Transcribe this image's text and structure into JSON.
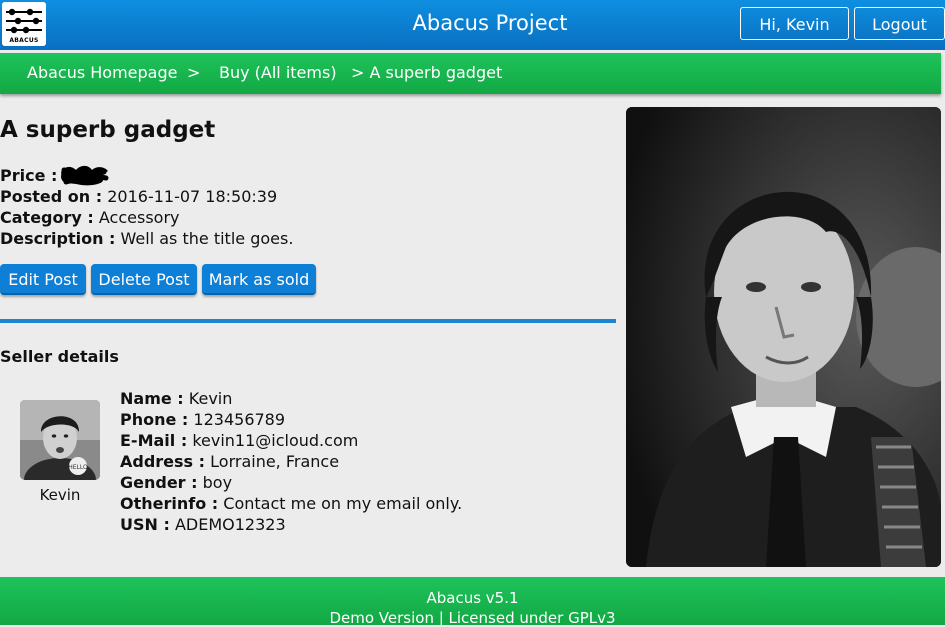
{
  "header": {
    "title": "Abacus Project",
    "logo_text": "ABACUS",
    "greeting_button": "Hi, Kevin",
    "logout_button": "Logout"
  },
  "breadcrumb": {
    "items": [
      "Abacus Homepage",
      "Buy (All items)",
      "> A superb gadget"
    ],
    "separator": ">"
  },
  "post": {
    "title": "A superb gadget",
    "price_label": "Price :",
    "posted_label": "Posted on :",
    "posted_value": "2016-11-07 18:50:39",
    "category_label": "Category :",
    "category_value": "Accessory",
    "description_label": "Description :",
    "description_value": "Well as the title goes."
  },
  "actions": {
    "edit": "Edit Post",
    "delete": "Delete Post",
    "mark_sold": "Mark as sold"
  },
  "seller": {
    "heading": "Seller details",
    "avatar_caption": "Kevin",
    "fields": [
      {
        "label": "Name :",
        "value": "Kevin"
      },
      {
        "label": "Phone :",
        "value": "123456789"
      },
      {
        "label": "E-Mail :",
        "value": "kevin11@icloud.com"
      },
      {
        "label": "Address :",
        "value": "Lorraine, France"
      },
      {
        "label": "Gender :",
        "value": "boy"
      },
      {
        "label": "Otherinfo :",
        "value": "Contact me on my email only."
      },
      {
        "label": "USN :",
        "value": "ADEMO12323"
      }
    ]
  },
  "footer": {
    "version": "Abacus v5.1",
    "license": "Demo Version | Licensed under GPLv3"
  },
  "colors": {
    "header_blue": "#0a7fd0",
    "bar_green": "#17b34f",
    "button_blue": "#0d7fd6",
    "divider_blue": "#1d85d0"
  }
}
